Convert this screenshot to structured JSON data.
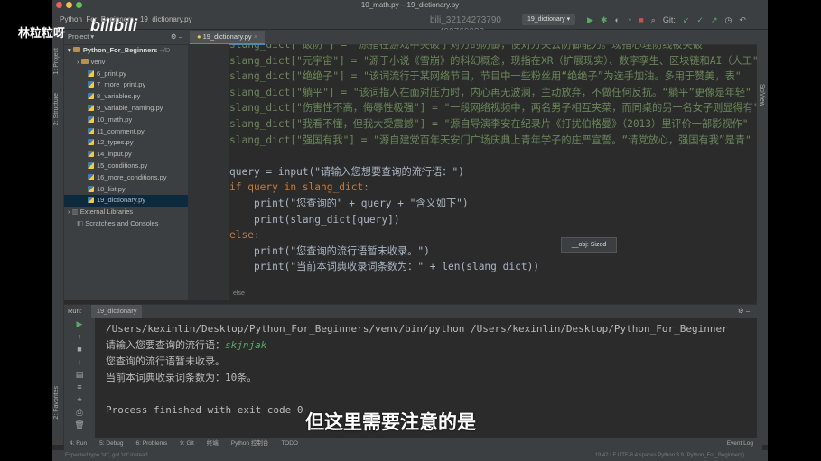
{
  "window": {
    "title": "10_math.py – 19_dictionary.py"
  },
  "navbar": {
    "breadcrumb": "Python_For_Beginners › 19_dictionary.py",
    "run_config": "19_dictionary ▾",
    "git_label": "Git:"
  },
  "watermark": {
    "line1": "bili_32124273790",
    "line2": "499760028"
  },
  "overlay": {
    "channel": "林粒粒呀",
    "logo": "bilibili",
    "subtitle": "但这里需要注意的是"
  },
  "sidebar_labels": {
    "project": "1: Project",
    "structure": "2: Structure",
    "favorites": "2: Favorites",
    "sciview": "SciView"
  },
  "project": {
    "header": "Project ▾",
    "root": "Python_For_Beginners",
    "root_path": "~/D",
    "folder": "venv",
    "files": [
      "6_print.py",
      "7_more_print.py",
      "8_variables.py",
      "9_variable_naming.py",
      "10_math.py",
      "11_comment.py",
      "12_types.py",
      "14_input.py",
      "15_conditions.py",
      "16_more_conditions.py",
      "18_list.py",
      "19_dictionary.py"
    ],
    "external": "External Libraries",
    "scratches": "Scratches and Consoles"
  },
  "editor": {
    "tab": "19_dictionary.py",
    "lines": [
      {
        "n": "",
        "text": "slang_dict[\"破防\"] = \"原指在游戏中突破了对方的防御，使对方失去防御能力。现指心理防线被突破\""
      },
      {
        "n": "7",
        "text": "slang_dict[\"元宇宙\"] = \"源于小说《雪崩》的科幻概念，现指在XR（扩展现实）、数字孪生、区块链和AI（人工\""
      },
      {
        "n": "8",
        "text": "slang_dict[\"绝绝子\"] = \"该词流行于某网络节目，节目中一些粉丝用“绝绝子”为选手加油。多用于赞美，表\""
      },
      {
        "n": "9",
        "text": "slang_dict[\"躺平\"] = \"该词指人在面对压力时，内心再无波澜，主动放弃，不做任何反抗。“躺平”更像是年轻\""
      },
      {
        "n": "10",
        "text": "slang_dict[\"伤害性不高，侮辱性极强\"] = \"一段网络视频中，两名男子相互夹菜，而同桌的另一名女子则显得有\""
      },
      {
        "n": "11",
        "text": "slang_dict[\"我看不懂，但我大受震撼\"] = \"源自导演李安在纪录片《打扰伯格曼》（2013）里评价一部影视作\""
      },
      {
        "n": "12",
        "text": "slang_dict[\"强国有我\"] = \"源自建党百年天安门广场庆典上青年学子的庄严宣誓。“请党放心，强国有我”是青\""
      },
      {
        "n": "13",
        "text": ""
      },
      {
        "n": "14",
        "text": "query = input(\"请输入您想要查询的流行语：\")"
      },
      {
        "n": "14",
        "text": "if query in slang_dict:"
      },
      {
        "n": "15",
        "text": "    print(\"您查询的\" + query + \"含义如下\")"
      },
      {
        "n": "16",
        "text": "    print(slang_dict[query])"
      },
      {
        "n": "17",
        "text": "else:"
      },
      {
        "n": "18",
        "text": "    print(\"您查询的流行语暂未收录。\")"
      },
      {
        "n": "19",
        "text": "    print(\"当前本词典收录词条数为：\" + len(slang_dict))"
      }
    ],
    "tooltip": "__obj: Sized",
    "scope_crumb": "else"
  },
  "run": {
    "label": "Run:",
    "tab": "19_dictionary",
    "command": "/Users/kexinlin/Desktop/Python_For_Beginners/venv/bin/python /Users/kexinlin/Desktop/Python_For_Beginner",
    "prompt": "请输入您要查询的流行语：",
    "user_input": "skjnjak",
    "out1": "您查询的流行语暂未收录。",
    "out2": "当前本词典收录词条数为：10条。",
    "exit": "Process finished with exit code 0"
  },
  "bottom_tabs": [
    "4: Run",
    "5: Debug",
    "6: Problems",
    "9: Git",
    "终端",
    "Python 控制台",
    "TODO"
  ],
  "event_log": "Event Log",
  "status": {
    "message": "Expected type 'str', got 'int' instead",
    "right": "19:42  LF  UTF-8  4 spaces  Python 3.9 (Python_For_Beginners)"
  }
}
